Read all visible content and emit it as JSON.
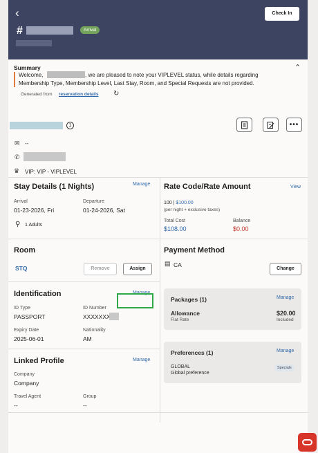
{
  "header": {
    "back_icon": "chevron-left-icon",
    "check_in_label": "Check In",
    "hash": "#",
    "status_badge": "Arrival"
  },
  "summary": {
    "title": "Summary",
    "welcome_prefix": "Welcome,",
    "text_line1": ", we are pleased to note your VIPLEVEL status, while details regarding",
    "text_line2": "Membership Type, Membership Level, Last Stay, Room, and Special Requests are not provided.",
    "generated_prefix": "Generated from",
    "generated_link": "reservation details"
  },
  "profile": {
    "info_badge": "1",
    "email": "--",
    "vip": "VIP: VIP - VIPLEVEL"
  },
  "stay": {
    "title": "Stay Details (1 Nights)",
    "manage": "Manage",
    "arrival_label": "Arrival",
    "arrival_value": "01-23-2026, Fri",
    "departure_label": "Departure",
    "departure_value": "01-24-2026, Sat",
    "guests": "1 Adults"
  },
  "rate": {
    "title": "Rate Code/Rate Amount",
    "view": "View",
    "rate_prefix": "100 | ",
    "rate_amount": "$100.00",
    "rate_note": "(per night + exclusive taxes)",
    "total_label": "Total Cost",
    "total_value": "$108.00",
    "balance_label": "Balance",
    "balance_value": "$0.00"
  },
  "room": {
    "title": "Room",
    "room_type": "STQ",
    "remove": "Remove",
    "assign": "Assign"
  },
  "payment": {
    "title": "Payment Method",
    "method": "CA",
    "change": "Change"
  },
  "identification": {
    "title": "Identification",
    "manage": "Manage",
    "id_type_label": "ID Type",
    "id_type_value": "PASSPORT",
    "id_number_label": "ID Number",
    "id_number_value": "XXXXXXX",
    "expiry_label": "Expiry Date",
    "expiry_value": "2025-06-01",
    "nationality_label": "Nationality",
    "nationality_value": "AM"
  },
  "packages": {
    "title": "Packages (1)",
    "manage": "Manage",
    "name": "Allowance",
    "rate_type": "Flat Rate",
    "amount": "$20.00",
    "included": "Included"
  },
  "preferences": {
    "title": "Preferences (1)",
    "manage": "Manage",
    "name": "GLOBAL",
    "desc": "Global preference",
    "chip": "Specials"
  },
  "linked_profile": {
    "title": "Linked Profile",
    "manage": "Manage",
    "company_label": "Company",
    "company_value": "Company",
    "travel_agent_label": "Travel Agent",
    "travel_agent_value": "--",
    "group_label": "Group",
    "group_value": "--"
  },
  "colors": {
    "header_bg": "#3d4462",
    "arrival_badge": "#74a35c",
    "link": "#2f68a8",
    "total": "#2f68a8",
    "balance": "#c0392b",
    "highlight": "#2fa84a",
    "fab": "#d8352a"
  }
}
